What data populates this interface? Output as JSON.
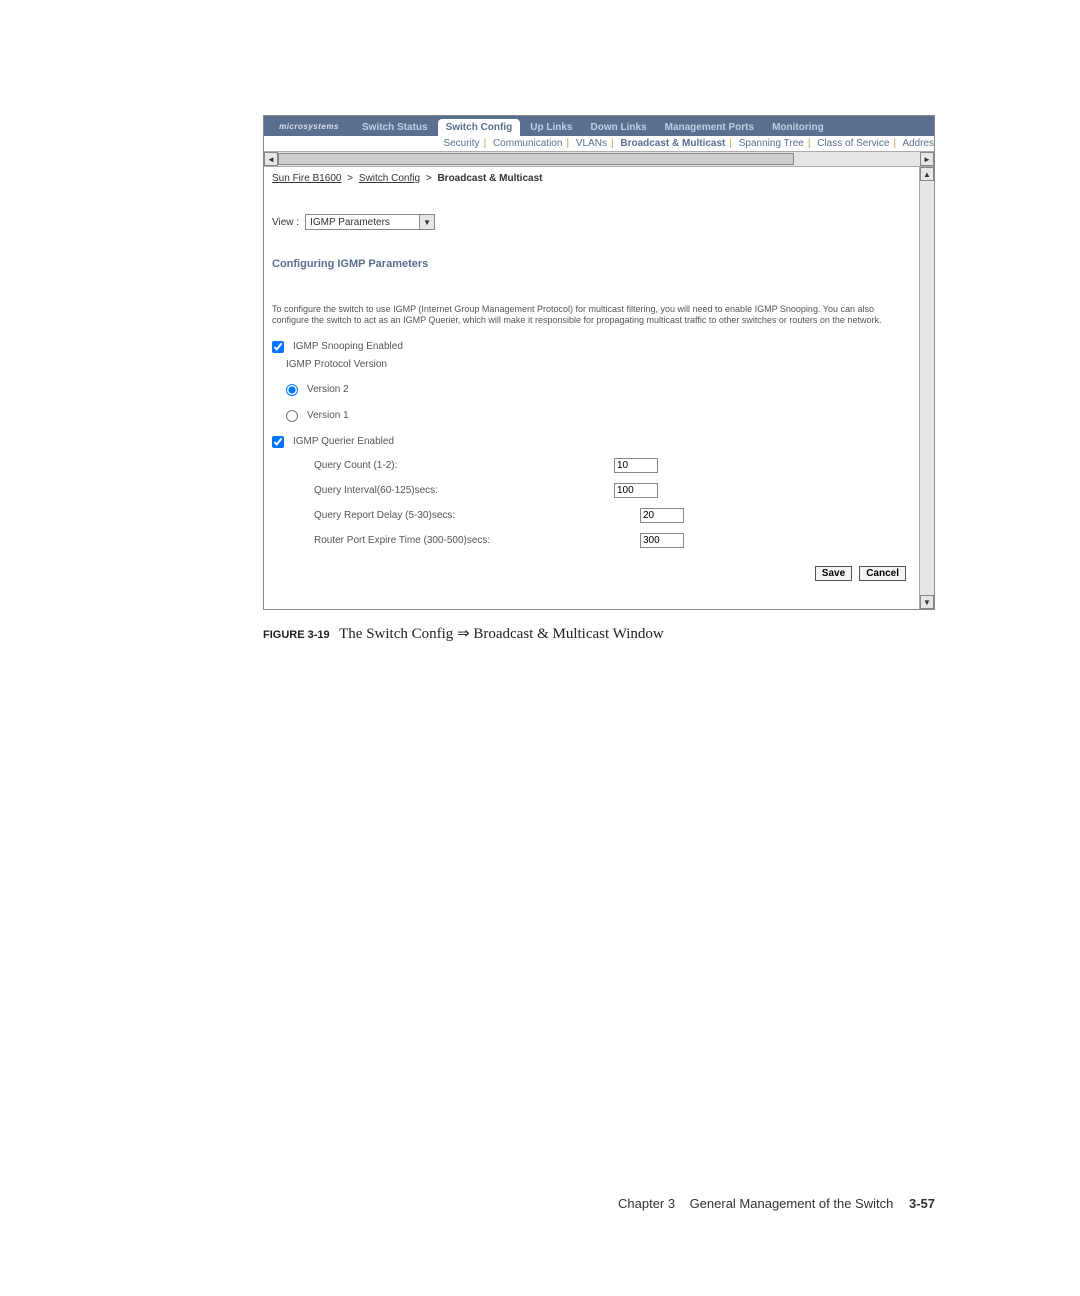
{
  "logo_text": "microsystems",
  "tabs": {
    "switch_status": "Switch Status",
    "switch_config": "Switch Config",
    "up_links": "Up Links",
    "down_links": "Down Links",
    "management_ports": "Management Ports",
    "monitoring": "Monitoring"
  },
  "subtabs": {
    "security": "Security",
    "communication": "Communication",
    "vlans": "VLANs",
    "broadcast_multicast": "Broadcast & Multicast",
    "spanning_tree": "Spanning Tree",
    "class_of_service": "Class of Service",
    "address": "Addres"
  },
  "breadcrumb": {
    "root": "Sun Fire B1600",
    "mid": "Switch Config",
    "current": "Broadcast & Multicast",
    "sep": ">"
  },
  "view": {
    "label": "View :",
    "selected": "IGMP Parameters"
  },
  "section_heading": "Configuring IGMP Parameters",
  "description": "To configure the switch to use IGMP (Internet Group Management Protocol) for multicast filtering, you will need to enable IGMP Snooping. You can also configure the switch to act as an IGMP Querier, which will make it responsible for propagating multicast traffic to other switches or routers on the network.",
  "form": {
    "snooping_label": "IGMP Snooping Enabled",
    "snooping_checked": true,
    "protocol_version_label": "IGMP Protocol Version",
    "version2_label": "Version 2",
    "version1_label": "Version 1",
    "version_selected": "2",
    "querier_label": "IGMP Querier Enabled",
    "querier_checked": true,
    "params": {
      "query_count": {
        "label": "Query Count (1-2):",
        "value": "10"
      },
      "query_interval": {
        "label": "Query Interval(60-125)secs:",
        "value": "100"
      },
      "query_report_delay": {
        "label": "Query Report Delay (5-30)secs:",
        "value": "20"
      },
      "router_port_expire": {
        "label": "Router Port Expire Time (300-500)secs:",
        "value": "300"
      }
    }
  },
  "buttons": {
    "save": "Save",
    "cancel": "Cancel"
  },
  "caption": {
    "fig_label": "FIGURE 3-19",
    "text": "The Switch Config ⇒ Broadcast & Multicast Window"
  },
  "footer": {
    "chapter": "Chapter 3",
    "title": "General Management of the Switch",
    "page": "3-57"
  }
}
